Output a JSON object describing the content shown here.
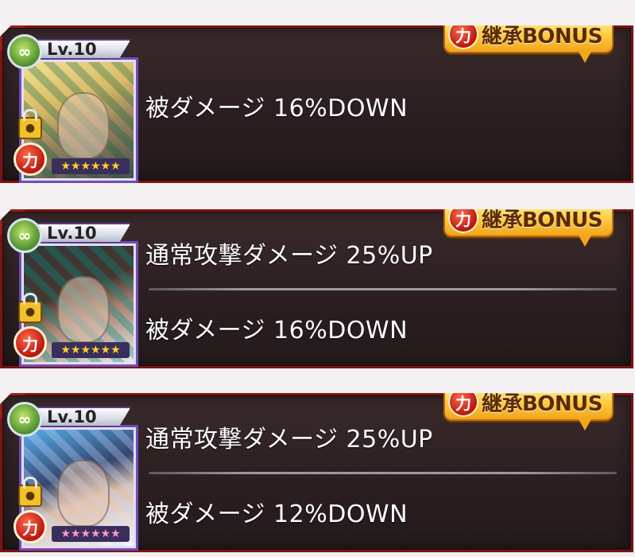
{
  "bonus_label": "継承BONUS",
  "bonus_icon_char": "力",
  "chara_badge_char": "力",
  "cards": [
    {
      "level": "Lv.10",
      "stars": "★★★★★★",
      "lines": [
        "被ダメージ 16%DOWN"
      ]
    },
    {
      "level": "Lv.10",
      "stars": "★★★★★★",
      "lines": [
        "通常攻撃ダメージ 25%UP",
        "被ダメージ 16%DOWN"
      ]
    },
    {
      "level": "Lv.10",
      "stars": "★★★★★★",
      "lines": [
        "通常攻撃ダメージ 25%UP",
        "被ダメージ 12%DOWN"
      ]
    }
  ],
  "icons": {
    "link": "link-icon",
    "lock": "lock-icon",
    "bonus": "power-icon",
    "chara": "power-attribute-icon"
  },
  "colors": {
    "card_border": "#7a1414",
    "bonus_gold": "#ffd24a",
    "text": "#ffffff"
  }
}
